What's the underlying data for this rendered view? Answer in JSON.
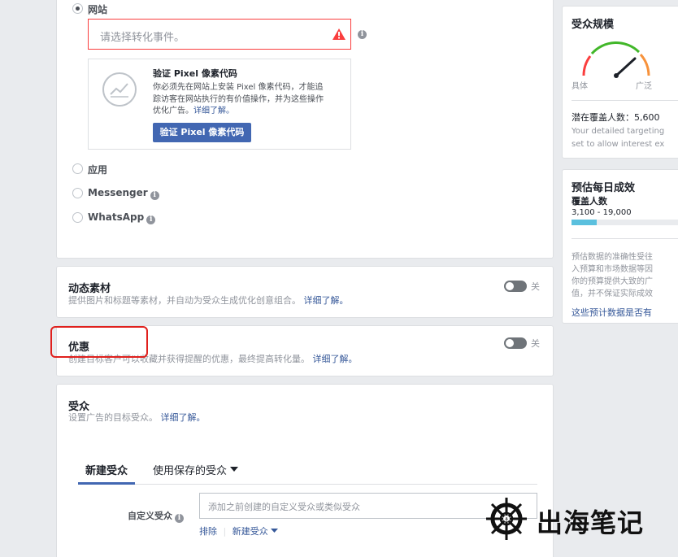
{
  "conversion": {
    "options": [
      {
        "label": "网站",
        "selected": true
      },
      {
        "label": "应用",
        "selected": false
      },
      {
        "label": "Messenger",
        "selected": false
      },
      {
        "label": "WhatsApp",
        "selected": false
      }
    ],
    "event_placeholder": "请选择转化事件。",
    "pixel": {
      "title": "验证 Pixel 像素代码",
      "desc_1": "你必须先在网站上安装 Pixel 像素代码，才能追",
      "desc_2": "踪访客在网站执行的有价值操作，并为这些操作",
      "desc_3": "优化广告。",
      "learn_more": "详细了解。",
      "button": "验证 Pixel 像素代码"
    }
  },
  "dynamic_creative": {
    "title": "动态素材",
    "desc": "提供图片和标题等素材，并自动为受众生成优化创意组合。",
    "learn_more": "详细了解。",
    "toggle_state": "关"
  },
  "offer": {
    "title": "优惠",
    "desc": "创建目标客户可以收藏并获得提醒的优惠，最终提高转化量。",
    "learn_more": "详细了解。",
    "toggle_state": "关"
  },
  "audience": {
    "title": "受众",
    "desc": "设置广告的目标受众。",
    "learn_more": "详细了解。",
    "tabs": [
      "新建受众",
      "使用保存的受众"
    ],
    "custom_audience_label": "自定义受众",
    "custom_audience_placeholder": "添加之前创建的自定义受众或类似受众",
    "exclude": "排除",
    "new_audience": "新建受众"
  },
  "audience_size": {
    "title": "受众规模",
    "gauge_left": "具体",
    "gauge_right": "广泛",
    "potential_reach": "潜在覆盖人数：5,600",
    "note_1": "Your detailed targeting",
    "note_2": "set to allow interest ex"
  },
  "daily_results": {
    "title": "预估每日成效",
    "reach_label": "覆盖人数",
    "reach_value": "3,100 - 19,000",
    "bar_fill_fraction": 0.24,
    "note_1": "预估数据的准确性受往",
    "note_2": "入预算和市场数据等因",
    "note_3": "你的预算提供大致的广",
    "note_4": "值，并不保证实际成效",
    "link": "这些预计数据是否有"
  },
  "watermark": {
    "text": "出海笔记"
  },
  "colors": {
    "primary": "#4267b2",
    "error": "#fa3e3e",
    "link": "#365899",
    "gauge_green": "#42b72a",
    "gauge_red": "#fa3e3e",
    "gauge_orange": "#f7923b",
    "bar_fill": "#5bc0de"
  }
}
